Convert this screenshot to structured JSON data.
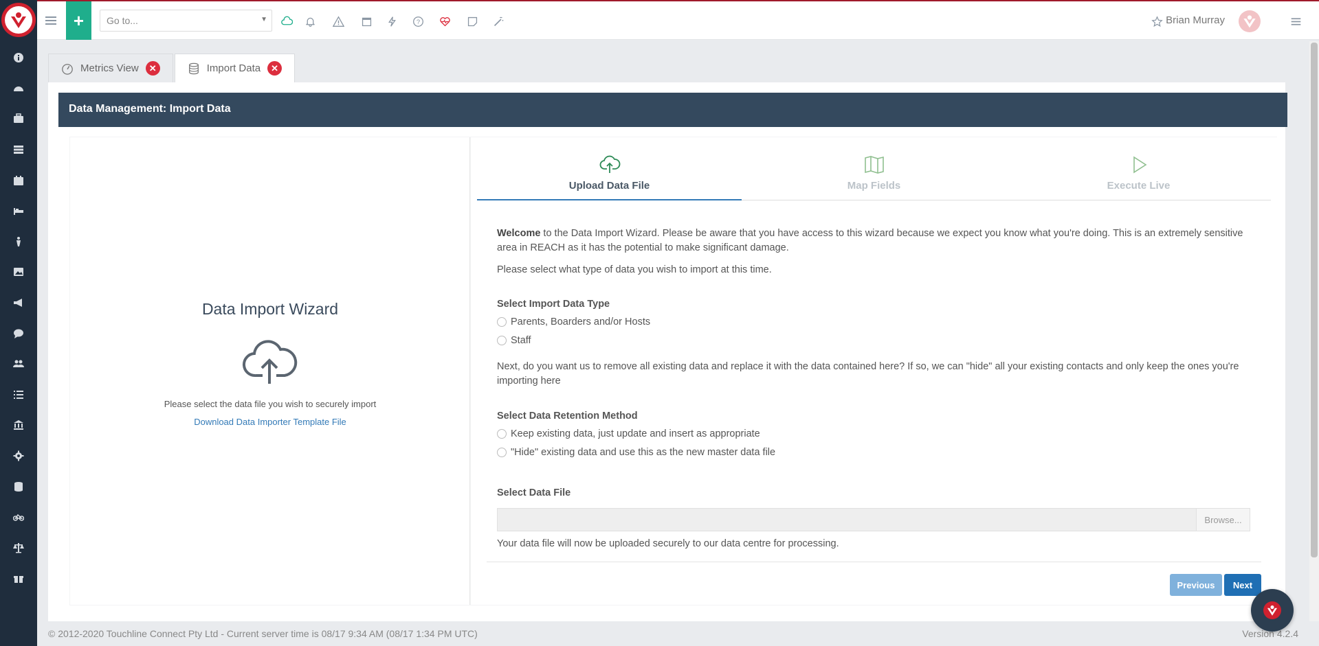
{
  "topbar": {
    "goto_placeholder": "Go to...",
    "user_name": "Brian Murray",
    "accent_color": "#1fae8c",
    "brand_color": "#d0212f"
  },
  "sidebar": {
    "icons": [
      "info-icon",
      "dashboard-icon",
      "briefcase-icon",
      "table-icon",
      "calendar-icon",
      "bed-icon",
      "person-icon",
      "image-icon",
      "megaphone-icon",
      "chat-icon",
      "users-icon",
      "list-icon",
      "bank-icon",
      "gear-icon",
      "database-icon",
      "bicycle-icon",
      "scale-icon",
      "gift-icon"
    ]
  },
  "tabs": [
    {
      "label": "Metrics View",
      "icon": "gauge-icon"
    },
    {
      "label": "Import Data",
      "icon": "database-icon"
    }
  ],
  "header": {
    "title": "Data Management: Import Data"
  },
  "left_panel": {
    "title": "Data Import Wizard",
    "instruction": "Please select the data file you wish to securely import",
    "download_link": "Download Data Importer Template File"
  },
  "steps": [
    {
      "label": "Upload Data File",
      "state": "active"
    },
    {
      "label": "Map Fields",
      "state": "inactive"
    },
    {
      "label": "Execute Live",
      "state": "inactive"
    }
  ],
  "form": {
    "welcome_bold": "Welcome",
    "welcome_rest": " to the Data Import Wizard. Please be aware that you have access to this wizard because we expect you know what you're doing. This is an extremely sensitive area in REACH as it has the potential to make significant damage.",
    "select_prompt": "Please select what type of data you wish to import at this time.",
    "import_type_label": "Select Import Data Type",
    "import_type_options": [
      "Parents, Boarders and/or Hosts",
      "Staff"
    ],
    "replace_prompt": "Next, do you want us to remove all existing data and replace it with the data contained here? If so, we can \"hide\" all your existing contacts and only keep the ones you're importing here",
    "retention_label": "Select Data Retention Method",
    "retention_options": [
      "Keep existing data, just update and insert as appropriate",
      "\"Hide\" existing data and use this as the new master data file"
    ],
    "file_label": "Select Data File",
    "browse_label": "Browse...",
    "upload_note": "Your data file will now be uploaded securely to our data centre for processing.",
    "previous_label": "Previous",
    "next_label": "Next"
  },
  "footer": {
    "copyright": "© 2012-2020 Touchline Connect Pty Ltd - Current server time is 08/17 9:34 AM (08/17 1:34 PM UTC)",
    "version": "Version 4.2.4"
  }
}
